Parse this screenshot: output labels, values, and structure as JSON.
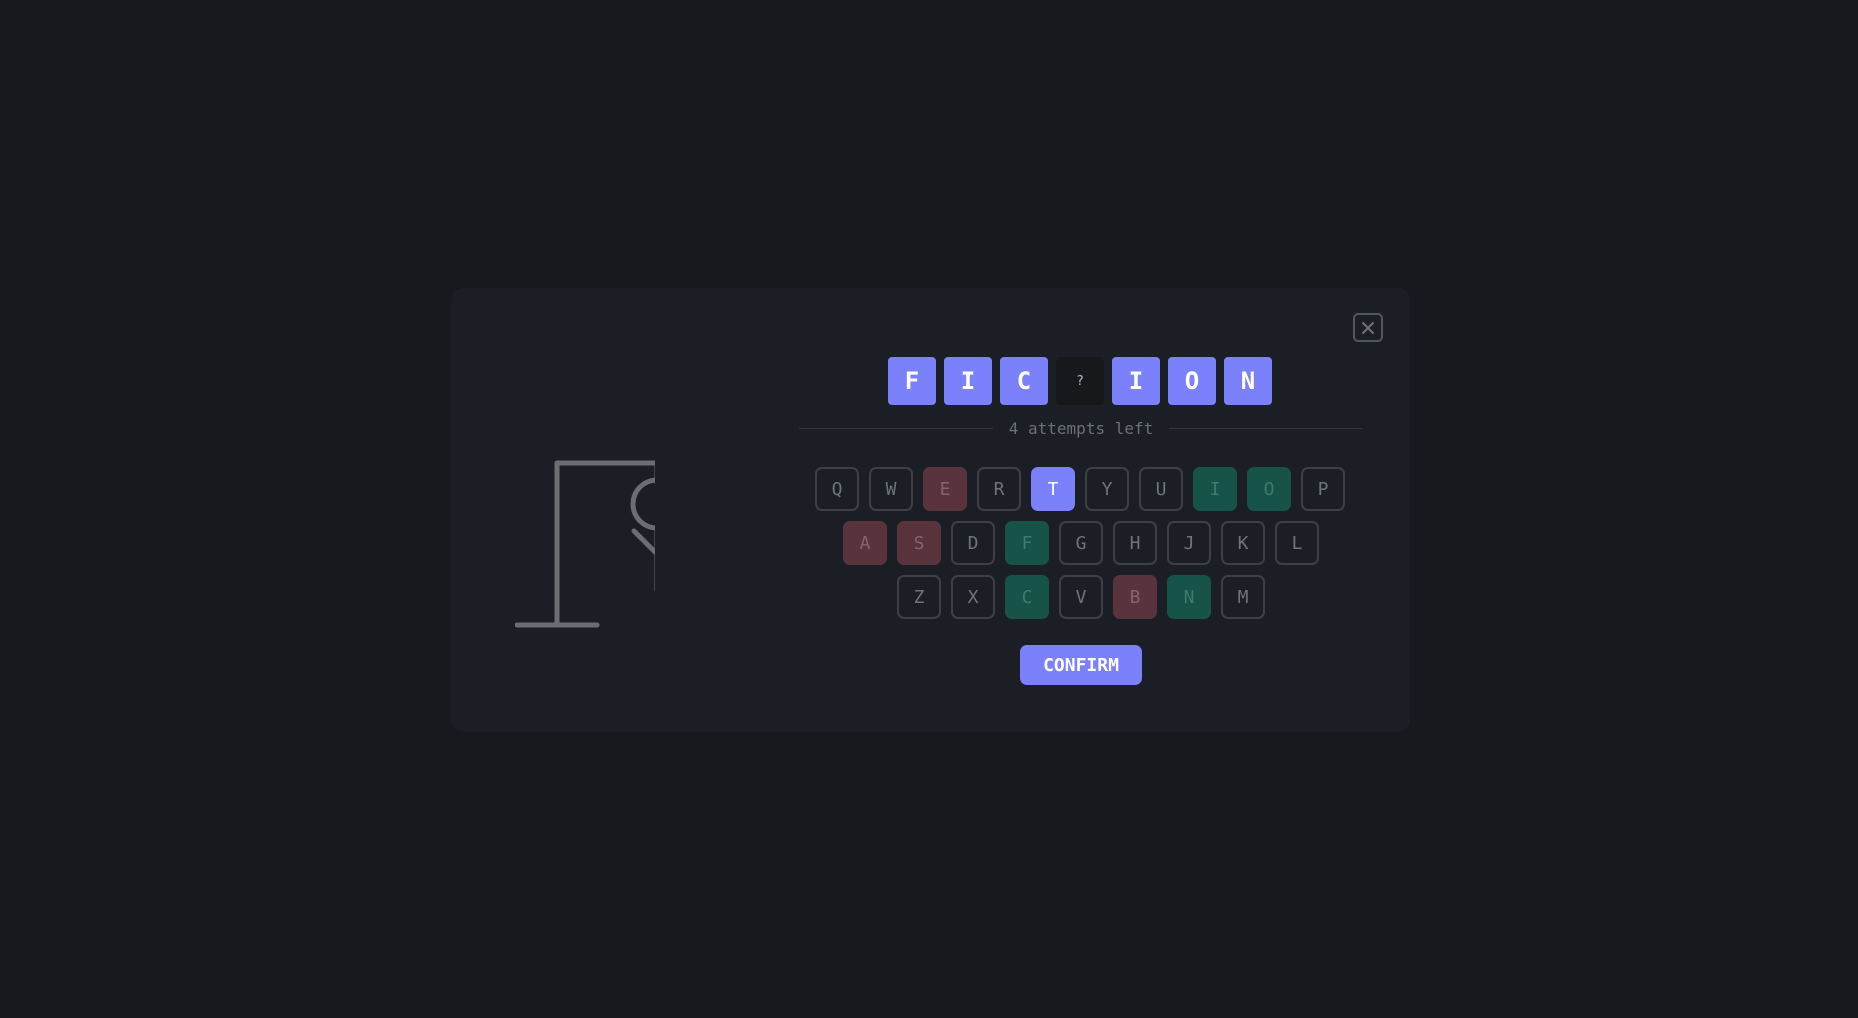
{
  "game": {
    "word_tiles": [
      {
        "letter": "F",
        "revealed": true
      },
      {
        "letter": "I",
        "revealed": true
      },
      {
        "letter": "C",
        "revealed": true
      },
      {
        "letter": "?",
        "revealed": false
      },
      {
        "letter": "I",
        "revealed": true
      },
      {
        "letter": "O",
        "revealed": true
      },
      {
        "letter": "N",
        "revealed": true
      }
    ],
    "attempts_text": "4 attempts left",
    "confirm_label": "CONFIRM",
    "close_icon": "close-icon",
    "keyboard_rows": [
      [
        {
          "letter": "Q",
          "state": "unused"
        },
        {
          "letter": "W",
          "state": "unused"
        },
        {
          "letter": "E",
          "state": "wrong"
        },
        {
          "letter": "R",
          "state": "unused"
        },
        {
          "letter": "T",
          "state": "selected"
        },
        {
          "letter": "Y",
          "state": "unused"
        },
        {
          "letter": "U",
          "state": "unused"
        },
        {
          "letter": "I",
          "state": "correct"
        },
        {
          "letter": "O",
          "state": "correct"
        },
        {
          "letter": "P",
          "state": "unused"
        }
      ],
      [
        {
          "letter": "A",
          "state": "wrong"
        },
        {
          "letter": "S",
          "state": "wrong"
        },
        {
          "letter": "D",
          "state": "unused"
        },
        {
          "letter": "F",
          "state": "correct"
        },
        {
          "letter": "G",
          "state": "unused"
        },
        {
          "letter": "H",
          "state": "unused"
        },
        {
          "letter": "J",
          "state": "unused"
        },
        {
          "letter": "K",
          "state": "unused"
        },
        {
          "letter": "L",
          "state": "unused"
        }
      ],
      [
        {
          "letter": "Z",
          "state": "unused"
        },
        {
          "letter": "X",
          "state": "unused"
        },
        {
          "letter": "C",
          "state": "correct"
        },
        {
          "letter": "V",
          "state": "unused"
        },
        {
          "letter": "B",
          "state": "wrong"
        },
        {
          "letter": "N",
          "state": "correct"
        },
        {
          "letter": "M",
          "state": "unused"
        }
      ]
    ]
  },
  "colors": {
    "background": "#17191e",
    "panel": "#1b1e24",
    "accent": "#7b80fb",
    "wrong": "#5a343c",
    "correct": "#18534a",
    "gallows": "#6b6d71"
  }
}
